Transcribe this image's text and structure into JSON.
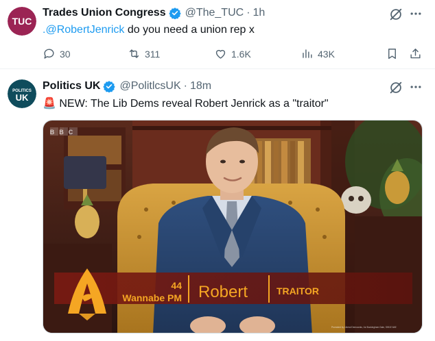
{
  "tweets": [
    {
      "author_name": "Trades Union Congress",
      "handle": "@The_TUC",
      "separator": "·",
      "time": "1h",
      "avatar_text": "TUC",
      "mention": ".@RobertJenrick",
      "text_rest": " do you need a union rep x",
      "stats": {
        "replies": "30",
        "retweets": "311",
        "likes": "1.6K",
        "views": "43K"
      }
    },
    {
      "author_name": "Politics UK",
      "handle": "@PolitlcsUK",
      "separator": "·",
      "time": "18m",
      "avatar_line1": "POLITICS",
      "avatar_line2": "UK",
      "text": "🚨 NEW: The Lib Dems reveal Robert Jenrick as a \"traitor\"",
      "media": {
        "channel_logo": "BBC",
        "number": "44",
        "role": "Wannabe PM",
        "name": "Robert",
        "tag": "TRAITOR",
        "credit": "Promoted by Liberal Democrats, 1st Buckingham Gate, SW1E 6AE"
      }
    }
  ],
  "icons": [
    "verified-badge-icon",
    "grok-icon",
    "more-icon",
    "reply-icon",
    "retweet-icon",
    "like-icon",
    "views-icon",
    "bookmark-icon",
    "share-icon"
  ],
  "colors": {
    "accent": "#1d9bf0",
    "muted": "#536471",
    "tuc": "#9b2454",
    "politics_uk": "#0f4c5c"
  }
}
